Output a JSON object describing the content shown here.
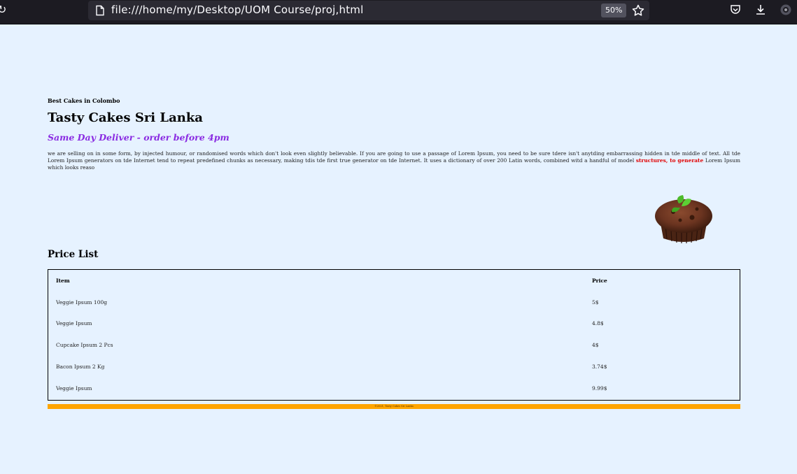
{
  "browser": {
    "url": "file:///home/my/Desktop/UOM Course/proj,html",
    "zoom": "50%"
  },
  "page": {
    "tagline": "Best Cakes in Colombo",
    "title": "Tasty Cakes Sri Lanka",
    "delivery": "Same Day Deliver - order before 4pm",
    "intro_text": "we are selling on in some form, by injected humour, or randomised words which don't look even slightly believable. If you are going to use a passage of Lorem Ipsum, you need to be sure tdere isn't anytding embarrassing hidden in tde middle of text. All tde Lorem Ipsum generators on tde Internet tend to repeat predefined chunks as necessary, making tdis tde first true generator on tde Internet. It uses a dictionary of over 200 Latin words, combined witd a handful of model ",
    "intro_highlight": "structures, to generate",
    "intro_tail": " Lorem Ipsum which looks reaso",
    "price_heading": "Price List",
    "table": {
      "headers": [
        "Item",
        "Price"
      ],
      "rows": [
        [
          "Veggie Ipsum 100g",
          "5$"
        ],
        [
          "Veggie Ipsum",
          "4.8$"
        ],
        [
          "Cupcake Ipsum 2 Pcs",
          "4$"
        ],
        [
          "Bacon Ipsum 2 Kg",
          "3.74$"
        ],
        [
          "Veggie Ipsum",
          "9.99$"
        ]
      ]
    },
    "footer": "©2021, Tasty Cakes Sri Lanka"
  },
  "colors": {
    "background": "#e6f2ff",
    "delivery": "#8a2be2",
    "highlight": "#e00000",
    "footer": "#ffa500"
  }
}
